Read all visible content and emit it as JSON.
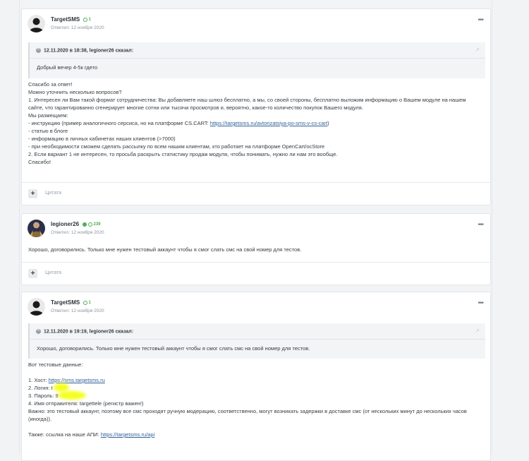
{
  "posts": [
    {
      "author": "TargetSMS",
      "reputation": "1",
      "date": "Ответил: 12 ноября 2020",
      "quote": {
        "header": "12.11.2020 в 18:38, legioner26 сказал:",
        "body": "Добрый вечер 4-5к гдето"
      },
      "lines": [
        "Спасибо за ответ!",
        "Можно уточнить несколько вопросов?",
        "1. Интересен ли Вам такой формат сотрудничества: Вы добавляете наш шлюз бесплатно, а мы, со своей стороны, бесплатно выложим информацию о Вашем модуле на нашем",
        "сайте, что гарантированно сгенерирует многие сотни или тысячи просмотров и, вероятно, какое-то количество покупок Вашего модуля.",
        "Мы размещаем:",
        "- статью в блоге",
        "- информацию в личных кабинетах наших клиентов (>7000)",
        "- при необходимости сможем сделать рассылку по всем нашим клиентам, кто работает на платформе OpenCart/ocStore",
        "2. Если вариант 1 не интересен, то просьба раскрыть статистику продаж модуля, чтобы понимать, нужно ли нам это вообще.",
        "Спасибо!"
      ],
      "instr_prefix": "- инструкцию (пример аналогичного серсиса, но на платформе CS.CART: ",
      "instr_link": "https://targetsms.ru/avtorizatsiya-po-sms-v-cs-cart",
      "instr_suffix": ")",
      "cite": "Цитата"
    },
    {
      "author": "legioner26",
      "reputation": "239",
      "date": "Ответил: 12 ноября 2020",
      "text": "Хорошо, договорились. Только мне нужен тестовый аккаунт чтобы я смог слать смс на свой номер для тестов.",
      "cite": "Цитата"
    },
    {
      "author": "TargetSMS",
      "reputation": "1",
      "date": "Ответил: 12 ноября 2020",
      "quote": {
        "header": "12.11.2020 в 19:19, legioner26 сказал:",
        "body": "Хорошо, договорились. Только мне нужен тестовый аккаунт чтобы я смог слать смс на свой номер для тестов."
      },
      "intro": "Вот тестовые данные:",
      "host_prefix": "1. Хост: ",
      "host_link": "https://sms.targetsms.ru",
      "login": "2. Логин: t",
      "password": "3. Пароль: 9",
      "sender": "4. Имя отправителя: targettele (регистр важен!)",
      "note1": "Важно: это тестовый аккаунт, поэтому все смс проходят ручную модерацию, соответственно, могут возникать задержки в доставке смс (от нескольких минут до нескольких часов",
      "note2": "(иногда)).",
      "api_prefix": "Также: ссылка на наше АПИ: ",
      "api_link": "https://targetsms.ru/api"
    }
  ],
  "colors": {
    "accent_green": "#4caf50",
    "link": "#2f5f97",
    "highlight": "#f4ff1e"
  }
}
